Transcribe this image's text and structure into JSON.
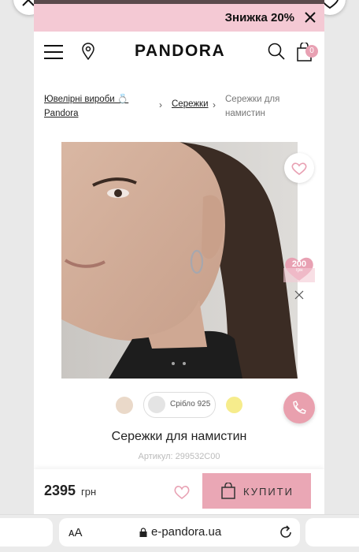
{
  "promo": {
    "text": "Знижка 20%"
  },
  "header": {
    "logo": "PANDORA",
    "cart_count": "0"
  },
  "breadcrumb": {
    "items": [
      {
        "label": "Ювелірні вироби 💍 Pandora"
      },
      {
        "label": "Сережки"
      },
      {
        "label": "Сережки для намистин"
      }
    ]
  },
  "product_image": {
    "alt": "Model wearing silver hoop earring"
  },
  "promo_badge": {
    "amount": "200",
    "unit": "грн"
  },
  "swatches": {
    "selected_label": "Срібло 925"
  },
  "product": {
    "title": "Сережки для намистин",
    "sku": "Артикул: 299532C00",
    "price": "2395",
    "currency": "грн",
    "buy_label": "КУПИТИ"
  },
  "browser": {
    "text_size": "ᴀA",
    "url": "e-pandora.ua"
  },
  "colors": {
    "brand_pink": "#f4c9d4",
    "buy_button": "#eaa7b5",
    "phone_button": "#e9a0ae"
  }
}
